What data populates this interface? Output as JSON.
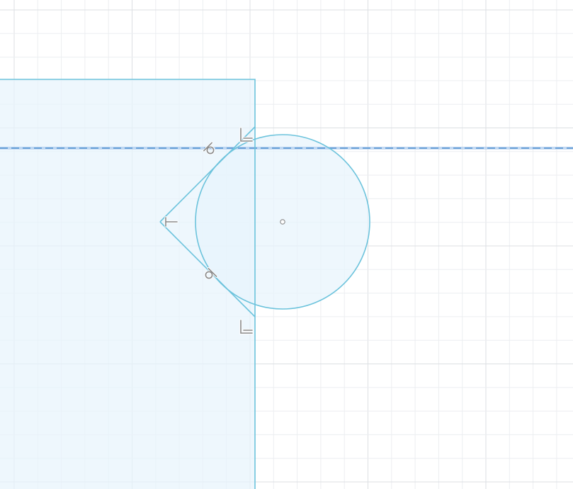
{
  "canvas": {
    "background": "#ffffff",
    "grid_minor_color": "#eceef1",
    "grid_major_color": "#dcdfe3"
  },
  "sketch": {
    "line_color": "#6cc3dc",
    "fill_color": "#e8f4fc",
    "construction_line_color": "#4f8fd0",
    "constraint_color": "#8a8a8a",
    "entities": [
      {
        "kind": "rectangle-profile",
        "name": "rectangle-profile"
      },
      {
        "kind": "circle",
        "name": "circle"
      },
      {
        "kind": "tangent-line",
        "name": "tangent-line-upper"
      },
      {
        "kind": "tangent-line",
        "name": "tangent-line-lower"
      },
      {
        "kind": "construction-line",
        "name": "horizontal-construction-line"
      },
      {
        "kind": "center-point",
        "name": "circle-center-point"
      }
    ],
    "constraints": [
      {
        "kind": "tangent",
        "icon": "tangent-constraint-icon",
        "name": "tangent-constraint-upper"
      },
      {
        "kind": "tangent",
        "icon": "tangent-constraint-icon",
        "name": "tangent-constraint-lower"
      },
      {
        "kind": "perpendicular",
        "icon": "perpendicular-constraint-icon",
        "name": "perpendicular-constraint-upper"
      },
      {
        "kind": "perpendicular",
        "icon": "perpendicular-constraint-icon",
        "name": "perpendicular-constraint-lower"
      },
      {
        "kind": "coincident-midpoint",
        "icon": "vertex-constraint-icon",
        "name": "vertex-constraint"
      }
    ]
  }
}
